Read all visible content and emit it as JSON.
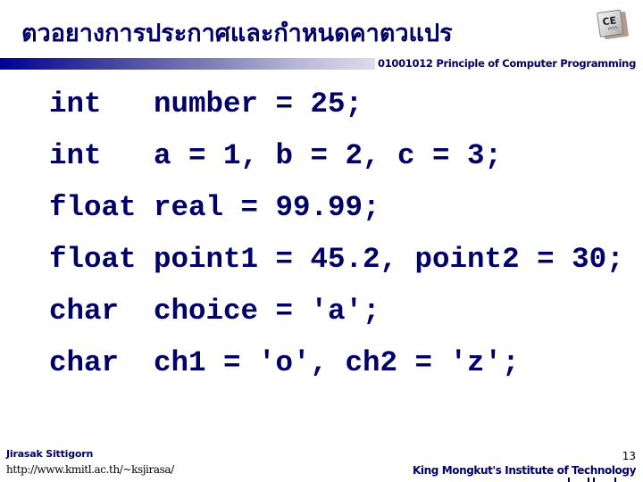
{
  "slide": {
    "title": "ตวอยางการประกาศและกำหนดคาตวแปร",
    "course": "01001012 Principle of Computer Programming",
    "logo": {
      "icon": "ce-logo-icon",
      "text": "CE",
      "subtext": "KMITL"
    }
  },
  "code": {
    "lines": [
      {
        "type": "int",
        "rest": "number = 25;"
      },
      {
        "type": "int",
        "rest": "a = 1, b = 2, c = 3;"
      },
      {
        "type": "float",
        "rest": "real = 99.99;"
      },
      {
        "type": "float",
        "rest": "point1 = 45.2, point2 = 30;"
      },
      {
        "type": "char",
        "rest": "choice = 'a';"
      },
      {
        "type": "char",
        "rest": "ch1 = 'o', ch2 = 'z';"
      }
    ]
  },
  "footer": {
    "author": "Jirasak Sittigorn",
    "url": "http://www.kmitl.ac.th/~ksjirasa/",
    "page_number": "13",
    "institute": "King Mongkut's Institute of Technology"
  },
  "colors": {
    "primary": "#000066",
    "bar_start": "#000099",
    "bar_end": "#dcdcec",
    "background": "#ffffff"
  }
}
